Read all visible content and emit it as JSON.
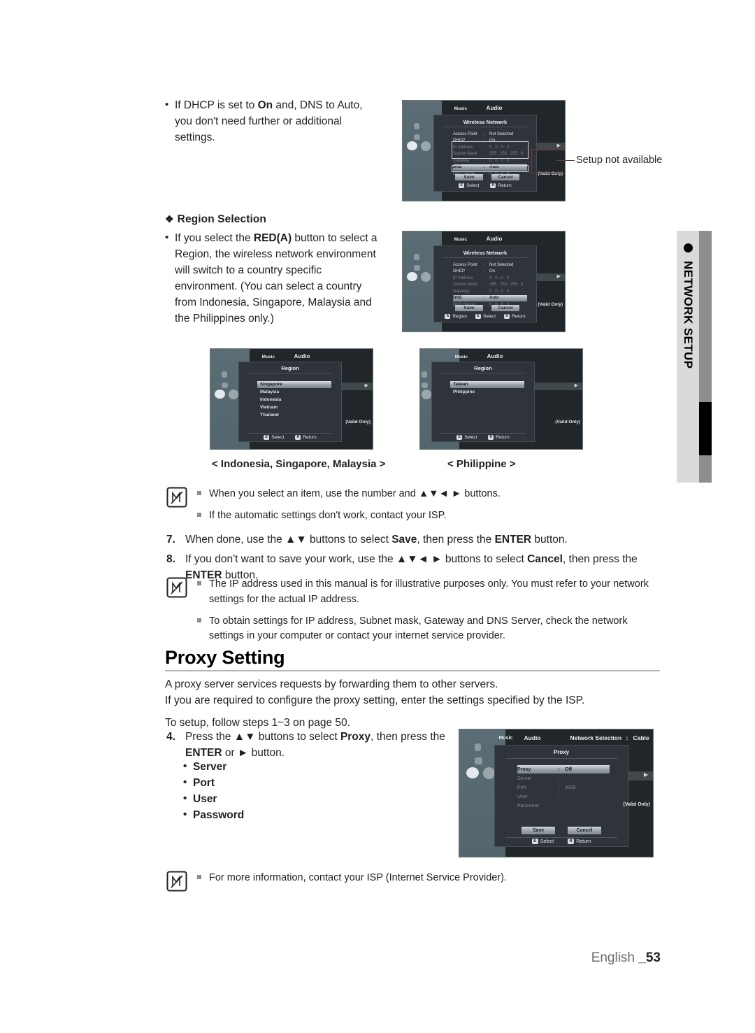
{
  "page": {
    "footer_language": "English ",
    "footer_page": "_53",
    "side_tab_label": "NETWORK SETUP"
  },
  "intro_bullet": {
    "line1_a": "If DHCP is set to ",
    "line1_b": "On",
    "line1_c": " and, DNS to Auto,",
    "line2": "you don't need further or additional",
    "line3": "settings."
  },
  "region_section": {
    "heading": "Region Selection",
    "bullet": {
      "l1_a": "If you select the ",
      "l1_b": "RED(A)",
      "l1_c": " button to select a",
      "l2": "Region, the wireless network environment",
      "l3": "will switch to a country specific",
      "l4": "environment. (You can select a country",
      "l5": "from Indonesia, Singapore, Malaysia and",
      "l6": "the Philippines only.)"
    }
  },
  "callout": {
    "setup_not_available": "Setup not available"
  },
  "captions": {
    "left": "< Indonesia, Singapore, Malaysia >",
    "right": "< Philippine >"
  },
  "tv1": {
    "menu_music": "Music",
    "menu_audio": "Audio",
    "dialog_title": "Wireless Network",
    "rows": [
      {
        "key": "Access Point",
        "sep": ":",
        "value": "Not Selected",
        "state": "normal"
      },
      {
        "key": "DHCP",
        "sep": ":",
        "value": "On",
        "state": "normal"
      },
      {
        "key": "IP Address",
        "sep": ":",
        "value": "0 . 0 . 0 . 0",
        "state": "dim"
      },
      {
        "key": "Subnet Mask",
        "sep": ":",
        "value": "255 . 255 . 255 . 0",
        "state": "dim"
      },
      {
        "key": "Gateway",
        "sep": ":",
        "value": "0 . 0 . 0 . 0",
        "state": "dim"
      },
      {
        "key": "DNS",
        "sep": ":",
        "value": "Auto",
        "state": "highlight"
      },
      {
        "key": "DNS Server",
        "sep": ":",
        "value": "0 . 0 . 0 . 0",
        "state": "dim"
      }
    ],
    "save": "Save",
    "cancel": "Cancel",
    "footer": [
      {
        "keycap": "E",
        "label": "Select"
      },
      {
        "keycap": "R",
        "label": "Return"
      }
    ],
    "valid_only": "(Valid Only)"
  },
  "tv2": {
    "menu_music": "Music",
    "menu_audio": "Audio",
    "dialog_title": "Wireless Network",
    "rows": [
      {
        "key": "Access Point",
        "sep": ":",
        "value": "Not Selected",
        "state": "normal"
      },
      {
        "key": "DHCP",
        "sep": ":",
        "value": "On",
        "state": "normal"
      },
      {
        "key": "IP Address",
        "sep": ":",
        "value": "0 . 0 . 0 . 0",
        "state": "dim"
      },
      {
        "key": "Subnet Mask",
        "sep": ":",
        "value": "255 . 255 . 255 . 0",
        "state": "dim"
      },
      {
        "key": "Gateway",
        "sep": ":",
        "value": "0 . 0 . 0 . 0",
        "state": "dim"
      },
      {
        "key": "DNS",
        "sep": ":",
        "value": "Auto",
        "state": "highlight"
      },
      {
        "key": "DNS Server",
        "sep": ":",
        "value": "0 . 0 . 0 . 0",
        "state": "dim"
      }
    ],
    "save": "Save",
    "cancel": "Cancel",
    "footer": [
      {
        "keycap": "A",
        "label": "Region"
      },
      {
        "keycap": "E",
        "label": "Select"
      },
      {
        "keycap": "R",
        "label": "Return"
      }
    ],
    "valid_only": "(Valid Only)"
  },
  "tv3": {
    "menu_music": "Music",
    "menu_audio": "Audio",
    "dialog_title": "Region",
    "items": [
      {
        "label": "Singapore",
        "selected": true
      },
      {
        "label": "Malaysia",
        "selected": false
      },
      {
        "label": "Indonesia",
        "selected": false
      },
      {
        "label": "Vietnam",
        "selected": false
      },
      {
        "label": "Thailand",
        "selected": false
      }
    ],
    "footer": [
      {
        "keycap": "E",
        "label": "Select"
      },
      {
        "keycap": "R",
        "label": "Return"
      }
    ],
    "valid_only": "(Valid Only)"
  },
  "tv4": {
    "menu_music": "Music",
    "menu_audio": "Audio",
    "dialog_title": "Region",
    "items": [
      {
        "label": "Taiwan",
        "selected": true
      },
      {
        "label": "Philippine",
        "selected": false
      }
    ],
    "footer": [
      {
        "keycap": "E",
        "label": "Select"
      },
      {
        "keycap": "R",
        "label": "Return"
      }
    ],
    "valid_only": "(Valid Only)"
  },
  "tv5": {
    "menu_music": "Music",
    "menu_audio": "Audio",
    "network_selection_label": "Network Selection",
    "network_selection_sep": ":",
    "network_selection_value": "Cable",
    "dialog_title": "Proxy",
    "rows": [
      {
        "key": "Proxy",
        "sep": ":",
        "value": "Off",
        "state": "highlight"
      },
      {
        "key": "Server",
        "sep": ":",
        "value": "",
        "state": "dim"
      },
      {
        "key": "Port",
        "sep": ":",
        "value": "3000",
        "state": "dim"
      },
      {
        "key": "User",
        "sep": ":",
        "value": "",
        "state": "dim"
      },
      {
        "key": "Password",
        "sep": ":",
        "value": "",
        "state": "dim"
      }
    ],
    "save": "Save",
    "cancel": "Cancel",
    "footer": [
      {
        "keycap": "E",
        "label": "Select"
      },
      {
        "keycap": "R",
        "label": "Return"
      }
    ],
    "valid_only": "(Valid Only)"
  },
  "note1": [
    "When you select an item, use the number and ▲▼◄ ► buttons.",
    "If the automatic settings don't work, contact your ISP."
  ],
  "steps_78": {
    "s7_num": "7.",
    "s7_a": "When done, use the ▲▼ buttons to select ",
    "s7_b": "Save",
    "s7_c": ", then press the ",
    "s7_d": "ENTER",
    "s7_e": " button.",
    "s8_num": "8.",
    "s8_a": "If you don't want to save your work, use the ▲▼◄ ► buttons to select ",
    "s8_b": "Cancel",
    "s8_c": ", then press the ",
    "s8_d": "ENTER",
    "s8_e": " button."
  },
  "note2": [
    "The IP address used in this manual is for illustrative purposes only. You must refer to your network settings for the actual IP address.",
    "To obtain settings for IP address, Subnet mask, Gateway and DNS Server, check the network settings in your computer or contact your internet service provider."
  ],
  "proxy_section": {
    "heading": "Proxy Setting",
    "para1": "A proxy server services requests by forwarding them to other servers.",
    "para2": "If you are required to configure the proxy setting, enter the settings specified by the ISP.",
    "para3": "To setup, follow steps 1~3 on page 50.",
    "step4": {
      "num": "4.",
      "a": "Press the ▲▼ buttons to select ",
      "b": "Proxy",
      "c": ", then press the ",
      "d": "ENTER",
      "e": " or ► button."
    },
    "sub_items": [
      "Server",
      "Port",
      "User",
      "Password"
    ]
  },
  "note3": [
    "For more information, contact your ISP (Internet Service Provider)."
  ]
}
